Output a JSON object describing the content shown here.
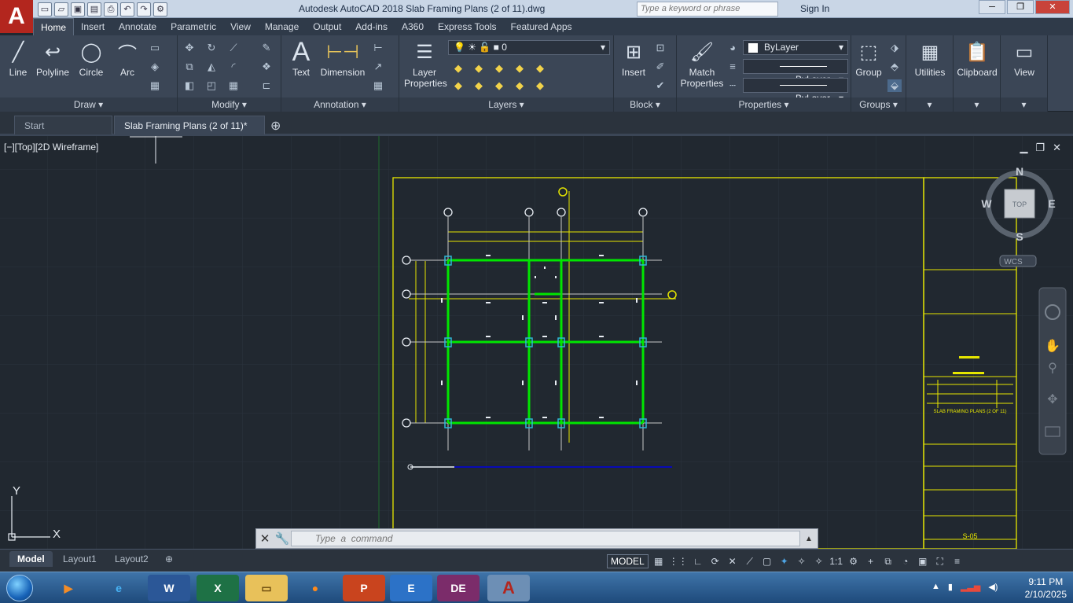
{
  "app": {
    "logo": "A",
    "title": "Autodesk AutoCAD 2018    Slab Framing Plans (2 of 11).dwg",
    "search_placeholder": "Type a keyword or phrase",
    "sign_in": "Sign In"
  },
  "ribbon_tabs": [
    "Home",
    "Insert",
    "Annotate",
    "Parametric",
    "View",
    "Manage",
    "Output",
    "Add-ins",
    "A360",
    "Express Tools",
    "Featured Apps"
  ],
  "ribbon": {
    "draw": {
      "title": "Draw",
      "line": "Line",
      "polyline": "Polyline",
      "circle": "Circle",
      "arc": "Arc"
    },
    "modify": {
      "title": "Modify"
    },
    "annotation": {
      "title": "Annotation",
      "text": "Text",
      "dimension": "Dimension"
    },
    "layers": {
      "title": "Layers",
      "layer_properties": "Layer Properties",
      "current_layer": "0"
    },
    "block": {
      "title": "Block",
      "insert": "Insert"
    },
    "properties": {
      "title": "Properties",
      "match": "Match Properties",
      "color": "ByLayer",
      "linetype": "ByLayer",
      "lineweight": "ByLayer"
    },
    "groups": {
      "title": "Groups",
      "group": "Group"
    },
    "utilities": "Utilities",
    "clipboard": "Clipboard",
    "view": "View"
  },
  "doc_tabs": {
    "start": "Start",
    "active": "Slab Framing Plans (2 of 11)*"
  },
  "viewport": {
    "label": "[−][Top][2D Wireframe]",
    "viewcube": {
      "n": "N",
      "s": "S",
      "e": "E",
      "w": "W",
      "top": "TOP",
      "wcs": "WCS"
    },
    "ucs": {
      "x": "X",
      "y": "Y"
    }
  },
  "titleblock": {
    "drawing_title": "SLAB FRAMING PLANS (2 OF 11)",
    "sheet_no": "S-05"
  },
  "command": {
    "placeholder": "Type  a  command"
  },
  "layout_tabs": [
    "Model",
    "Layout1",
    "Layout2"
  ],
  "status": {
    "model": "MODEL",
    "scale": "1:1"
  },
  "taskbar": {
    "time": "9:11 PM",
    "date": "2/10/2025"
  },
  "colors": {
    "accent": "#b3261e",
    "drawing_border": "#e6e600",
    "beams": "#00e600",
    "grid_lines": "#c8c8c8",
    "columns": "#2fb7d6"
  }
}
